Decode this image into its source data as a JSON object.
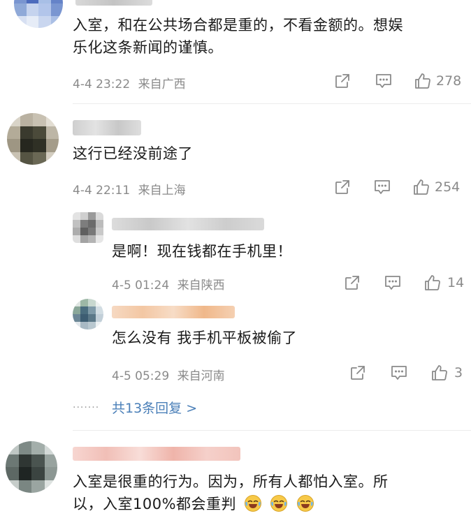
{
  "comments": [
    {
      "text": "入室，和在公共场合都是重的，不看金额的。想娱乐化这条新闻的谨慎。",
      "line1": "入室，和在公共场合都是重的，不看金额的。想娱",
      "line2": "乐化这条新闻的谨慎。",
      "time": "4-4 23:22",
      "location": "来自广西",
      "likes": "278"
    },
    {
      "text": "这行已经没前途了",
      "time": "4-4 22:11",
      "location": "来自上海",
      "likes": "254",
      "replies": [
        {
          "text": "是啊！现在钱都在手机里！",
          "time": "4-5 01:24",
          "location": "来自陕西",
          "likes": "14"
        },
        {
          "text": "怎么没有 我手机平板被偷了",
          "time": "4-5 05:29",
          "location": "来自河南",
          "likes": "3"
        }
      ],
      "more_replies": "共13条回复 >",
      "dots": "·······"
    },
    {
      "line1": "入室是很重的行为。因为，所有人都怕入室。所",
      "line2": "以，入室100%都会重判"
    }
  ],
  "icons": {
    "share": "share-icon",
    "comment": "comment-icon",
    "like": "thumbs-up-icon",
    "emoji": "laugh-cry-emoji-icon"
  },
  "colors": {
    "link": "#4a7fb8",
    "meta": "#8a8a8a"
  }
}
